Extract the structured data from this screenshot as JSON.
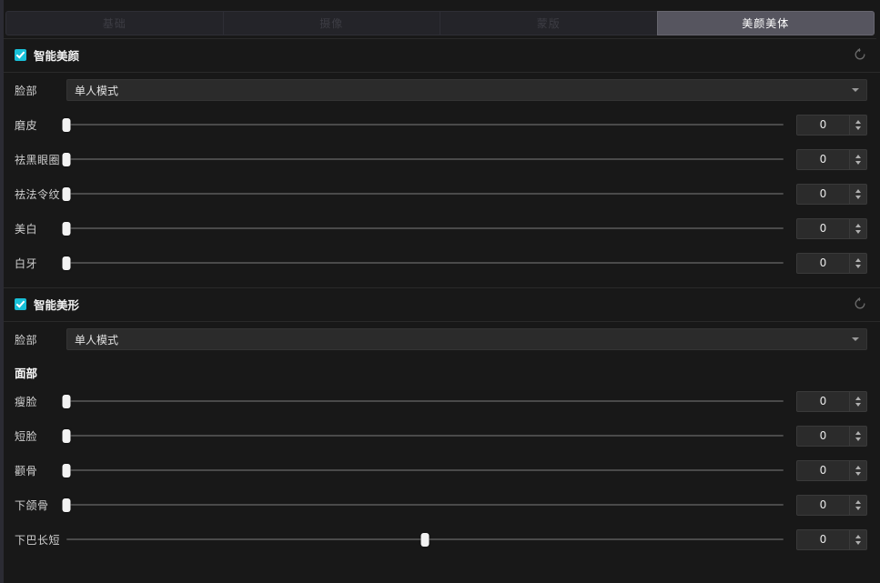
{
  "colors": {
    "accent": "#18c0d8",
    "active_tab_bg": "#56555f",
    "window_bg": "#181818",
    "handle": "#f2f2f2"
  },
  "tabs": [
    {
      "label": "基础",
      "active": false
    },
    {
      "label": "摄像",
      "active": false
    },
    {
      "label": "蒙版",
      "active": false
    },
    {
      "label": "美颜美体",
      "active": true
    }
  ],
  "sections": [
    {
      "title": "智能美颜",
      "enabled": true,
      "reset_icon": "reset-icon",
      "dropdown": {
        "label": "脸部",
        "value": "单人模式",
        "icon": "chevron-down-icon"
      },
      "sliders": [
        {
          "label": "磨皮",
          "value": "0",
          "percent": 0
        },
        {
          "label": "祛黑眼圈",
          "value": "0",
          "percent": 0
        },
        {
          "label": "祛法令纹",
          "value": "0",
          "percent": 0
        },
        {
          "label": "美白",
          "value": "0",
          "percent": 0
        },
        {
          "label": "白牙",
          "value": "0",
          "percent": 0
        }
      ]
    },
    {
      "title": "智能美形",
      "enabled": true,
      "reset_icon": "reset-icon",
      "dropdown": {
        "label": "脸部",
        "value": "单人模式",
        "icon": "chevron-down-icon"
      },
      "subheading": "面部",
      "sliders": [
        {
          "label": "瘦脸",
          "value": "0",
          "percent": 0
        },
        {
          "label": "短脸",
          "value": "0",
          "percent": 0
        },
        {
          "label": "颧骨",
          "value": "0",
          "percent": 0
        },
        {
          "label": "下颌骨",
          "value": "0",
          "percent": 0
        },
        {
          "label": "下巴长短",
          "value": "0",
          "percent": 50
        }
      ]
    }
  ]
}
